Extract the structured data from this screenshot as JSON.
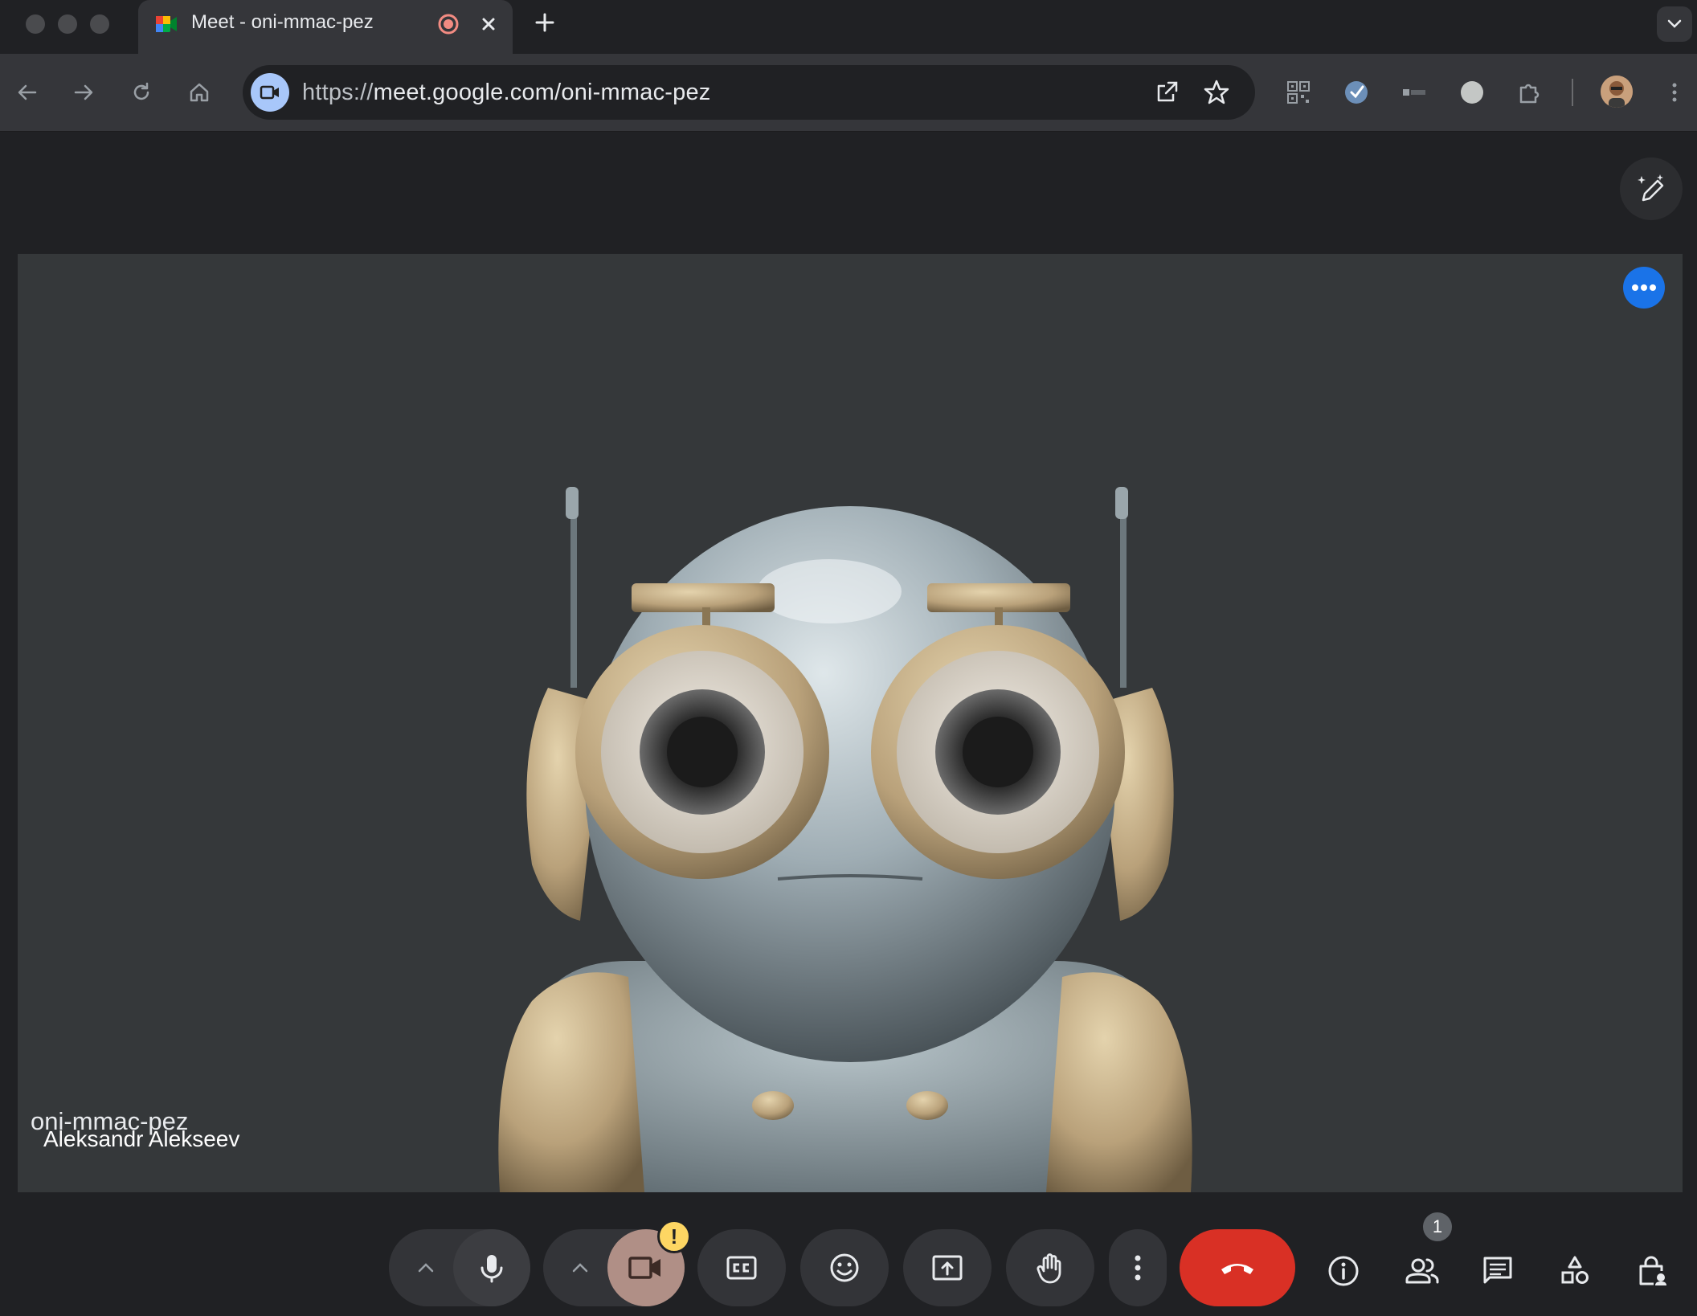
{
  "browser": {
    "tab": {
      "title": "Meet - oni-mmac-pez",
      "favicon": "google-meet-icon",
      "recording_indicator": "record-icon",
      "close_icon": "close-icon"
    },
    "new_tab_icon": "plus-icon",
    "tab_search_icon": "chevron-down-icon",
    "nav": {
      "back_icon": "arrow-back-icon",
      "forward_icon": "arrow-forward-icon",
      "reload_icon": "reload-icon",
      "home_icon": "home-icon"
    },
    "omnibox": {
      "site_icon": "video-camera-icon",
      "url_scheme": "https://",
      "url_rest": "meet.google.com/oni-mmac-pez",
      "open_in_app_icon": "open-external-icon",
      "bookmark_icon": "star-icon"
    },
    "extensions": [
      "qr-code-extension-icon",
      "checkmark-extension-icon",
      "vta-extension-icon",
      "circle-extension-icon",
      "puzzle-extensions-icon"
    ],
    "profile_icon": "profile-avatar",
    "menu_icon": "kebab-menu-icon"
  },
  "meet": {
    "effects_button_icon": "magic-pen-icon",
    "tile": {
      "participant_name": "Aleksandr Alekseev",
      "more_options_icon": "more-horiz-icon"
    },
    "meeting_code": "oni-mmac-pez",
    "controls": {
      "audio_options_icon": "chevron-up-icon",
      "mic_icon": "microphone-icon",
      "video_options_icon": "chevron-up-icon",
      "camera_icon": "videocam-icon",
      "camera_warning": "!",
      "captions_icon": "closed-captions-icon",
      "reactions_icon": "emoji-icon",
      "present_icon": "present-screen-icon",
      "raise_hand_icon": "hand-icon",
      "more_icon": "more-vert-icon",
      "leave_icon": "call-end-icon"
    },
    "side_controls": {
      "info_icon": "info-icon",
      "people_icon": "people-icon",
      "people_count": "1",
      "chat_icon": "chat-icon",
      "activities_icon": "activities-icon",
      "host_controls_icon": "lock-person-icon"
    },
    "colors": {
      "leave_red": "#d93025",
      "camera_off_bg": "#b08f86",
      "warning_yellow": "#fdd663",
      "more_blue": "#1a73e8"
    }
  }
}
